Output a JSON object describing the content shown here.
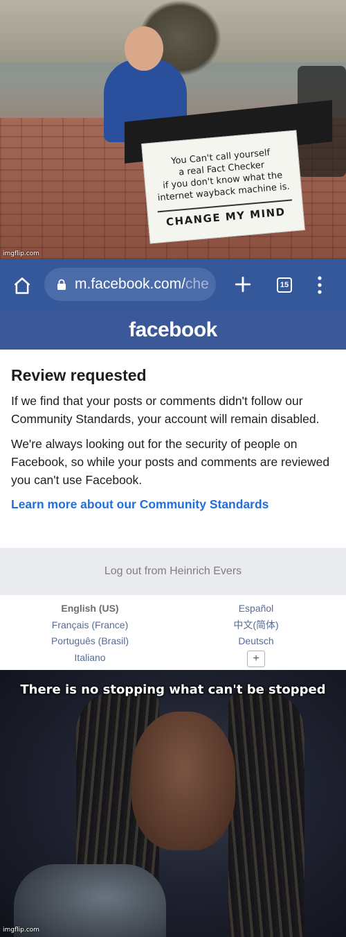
{
  "top_meme": {
    "sign_lines": [
      "You Can't call yourself",
      "a real Fact Checker",
      "if you don't know what the",
      "internet wayback machine is."
    ],
    "sign_cta": "CHANGE MY MIND",
    "watermark": "imgflip.com"
  },
  "browser": {
    "url_host": "m.facebook.com/",
    "url_path": "che",
    "tab_count": "15"
  },
  "facebook": {
    "logo": "facebook",
    "title": "Review requested",
    "paragraph1": "If we find that your posts or comments didn't follow our Community Standards, your account will remain disabled.",
    "paragraph2": "We're always looking out for the security of people on Facebook, so while your posts and comments are reviewed you can't use Facebook.",
    "learn_more": "Learn more about our Community Standards",
    "logout": "Log out from Heinrich Evers",
    "languages_left": [
      "English (US)",
      "Français (France)",
      "Português (Brasil)",
      "Italiano"
    ],
    "languages_right": [
      "Español",
      "中文(简体)",
      "Deutsch"
    ],
    "more_languages": "+"
  },
  "bottom_meme": {
    "caption": "There is no stopping what can't be stopped",
    "watermark": "imgflip.com"
  },
  "colors": {
    "browser_bar": "#34589a",
    "fb_header": "#3b5998",
    "link_blue": "#216fdb",
    "logout_bg": "#e9ebee"
  }
}
